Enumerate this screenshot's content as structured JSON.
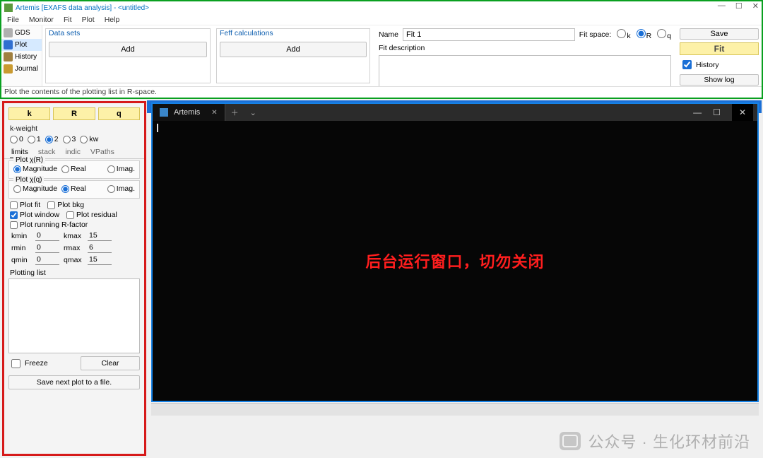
{
  "main": {
    "title": "Artemis [EXAFS data analysis] - <untitled>",
    "menu": [
      "File",
      "Monitor",
      "Fit",
      "Plot",
      "Help"
    ],
    "sidebar": [
      {
        "label": "GDS",
        "sel": false
      },
      {
        "label": "Plot",
        "sel": true
      },
      {
        "label": "History",
        "sel": false
      },
      {
        "label": "Journal",
        "sel": false
      }
    ],
    "datasets": {
      "title": "Data sets",
      "add": "Add"
    },
    "feff": {
      "title": "Feff calculations",
      "add": "Add"
    },
    "name_label": "Name",
    "name_value": "Fit 1",
    "fitspace_label": "Fit space:",
    "fitspace_opts": [
      "k",
      "R",
      "q"
    ],
    "fitspace_sel": "R",
    "desc_label": "Fit description",
    "save": "Save",
    "fit": "Fit",
    "history": "History",
    "showlog": "Show log",
    "status": "Plot the contents of the plotting list in R-space."
  },
  "plot": {
    "krq": [
      "k",
      "R",
      "q"
    ],
    "kweight_label": "k-weight",
    "kweights": [
      "0",
      "1",
      "2",
      "3",
      "kw"
    ],
    "kweight_sel": "2",
    "tabs": [
      "limits",
      "stack",
      "indic",
      "VPaths"
    ],
    "tab_sel": "limits",
    "chiR": {
      "title": "Plot χ(R)",
      "opts": [
        "Magnitude",
        "Real",
        "Imag."
      ],
      "sel": "Magnitude"
    },
    "chiQ": {
      "title": "Plot χ(q)",
      "opts": [
        "Magnitude",
        "Real",
        "Imag."
      ],
      "sel": "Real"
    },
    "checks": {
      "plotfit": {
        "label": "Plot fit",
        "val": false
      },
      "plotbkg": {
        "label": "Plot bkg",
        "val": false
      },
      "plotwin": {
        "label": "Plot window",
        "val": true
      },
      "plotres": {
        "label": "Plot residual",
        "val": false
      },
      "plotrf": {
        "label": "Plot running R-factor",
        "val": false
      }
    },
    "ranges": {
      "kmin": "0",
      "kmax": "15",
      "rmin": "0",
      "rmax": "6",
      "qmin": "0",
      "qmax": "15"
    },
    "range_labels": {
      "kmin": "kmin",
      "kmax": "kmax",
      "rmin": "rmin",
      "rmax": "rmax",
      "qmin": "qmin",
      "qmax": "qmax"
    },
    "plist": "Plotting list",
    "freeze": "Freeze",
    "clear": "Clear",
    "savefile": "Save next plot to a file."
  },
  "console": {
    "tab": "Artemis",
    "msg": "后台运行窗口，切勿关闭"
  },
  "watermark": {
    "text": "公众号 · 生化环材前沿"
  }
}
